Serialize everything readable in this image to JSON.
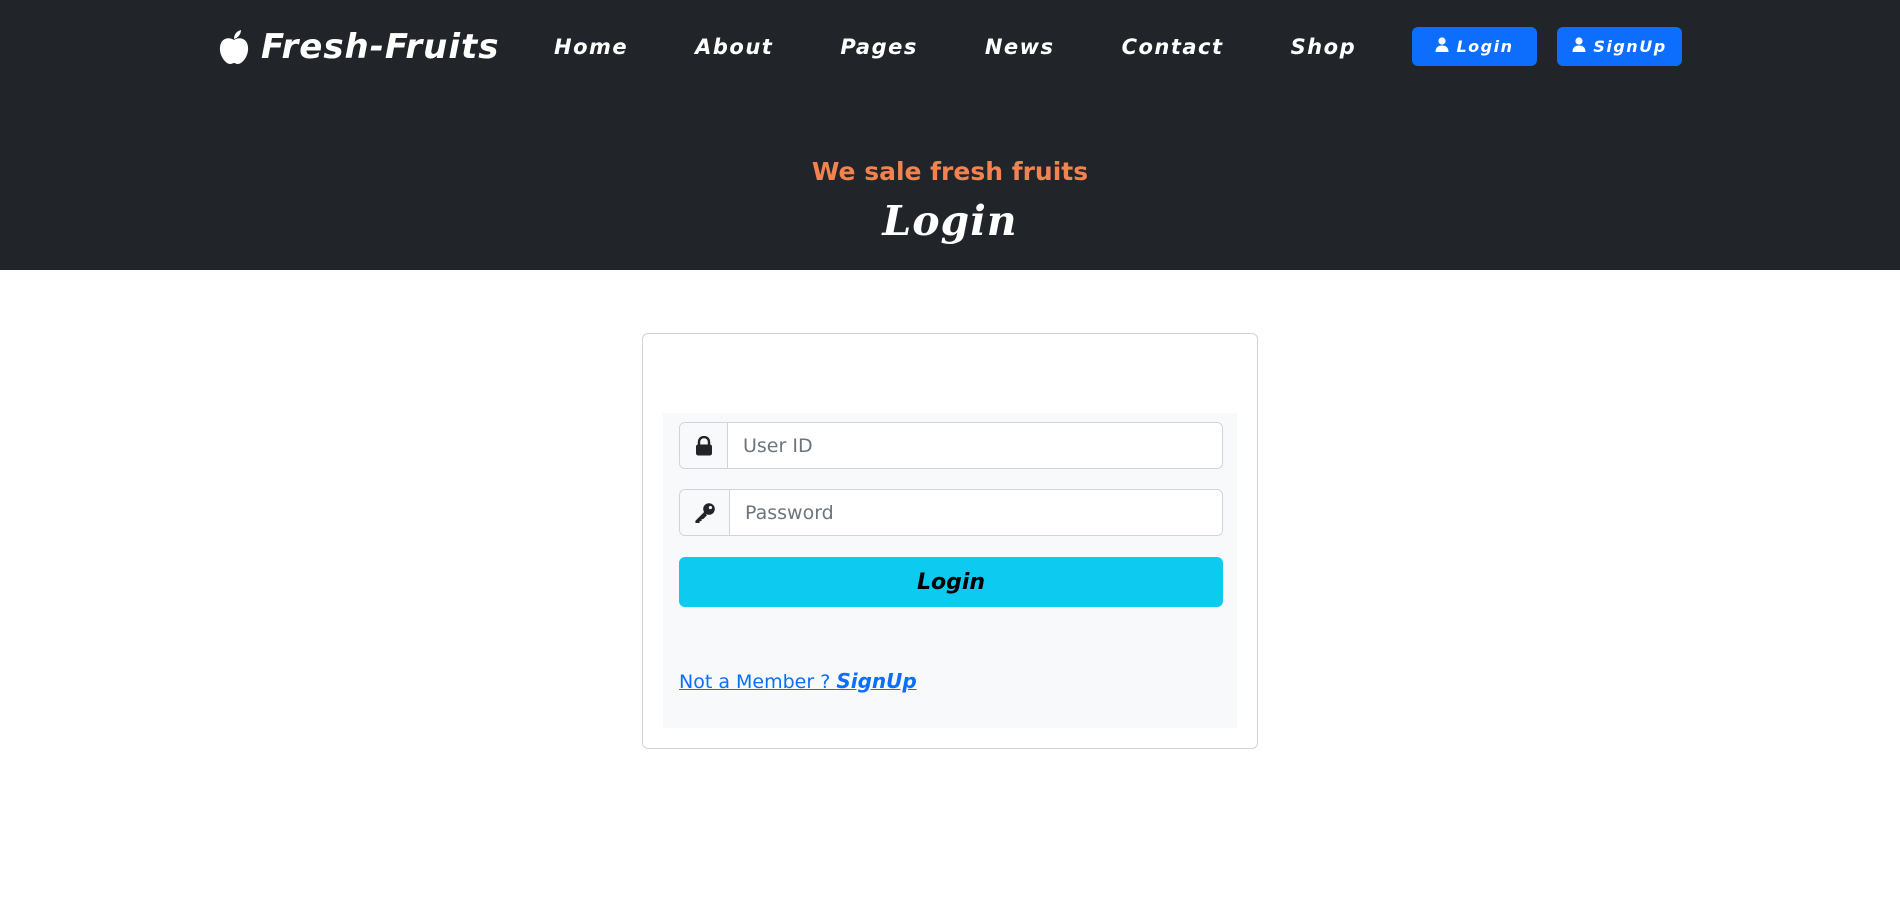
{
  "brand": {
    "name": "Fresh-Fruits",
    "icon": "apple-icon"
  },
  "nav": {
    "links": [
      "Home",
      "About",
      "Pages",
      "News",
      "Contact",
      "Shop"
    ],
    "login_label": "Login",
    "signup_label": "SignUp",
    "user_icon": "user-icon"
  },
  "hero": {
    "tagline": "We sale fresh fruits",
    "title": "Login"
  },
  "form": {
    "user_id": {
      "placeholder": "User ID",
      "value": "",
      "icon": "lock-icon"
    },
    "password": {
      "placeholder": "Password",
      "value": "",
      "icon": "key-icon"
    },
    "submit_label": "Login",
    "member_prompt": "Not a Member ? ",
    "member_link": "SignUp"
  },
  "colors": {
    "header_bg": "#212529",
    "tagline": "#f28350",
    "primary": "#0d6efd",
    "info": "#0dcaf0",
    "form_bg": "#f8f9fa"
  }
}
